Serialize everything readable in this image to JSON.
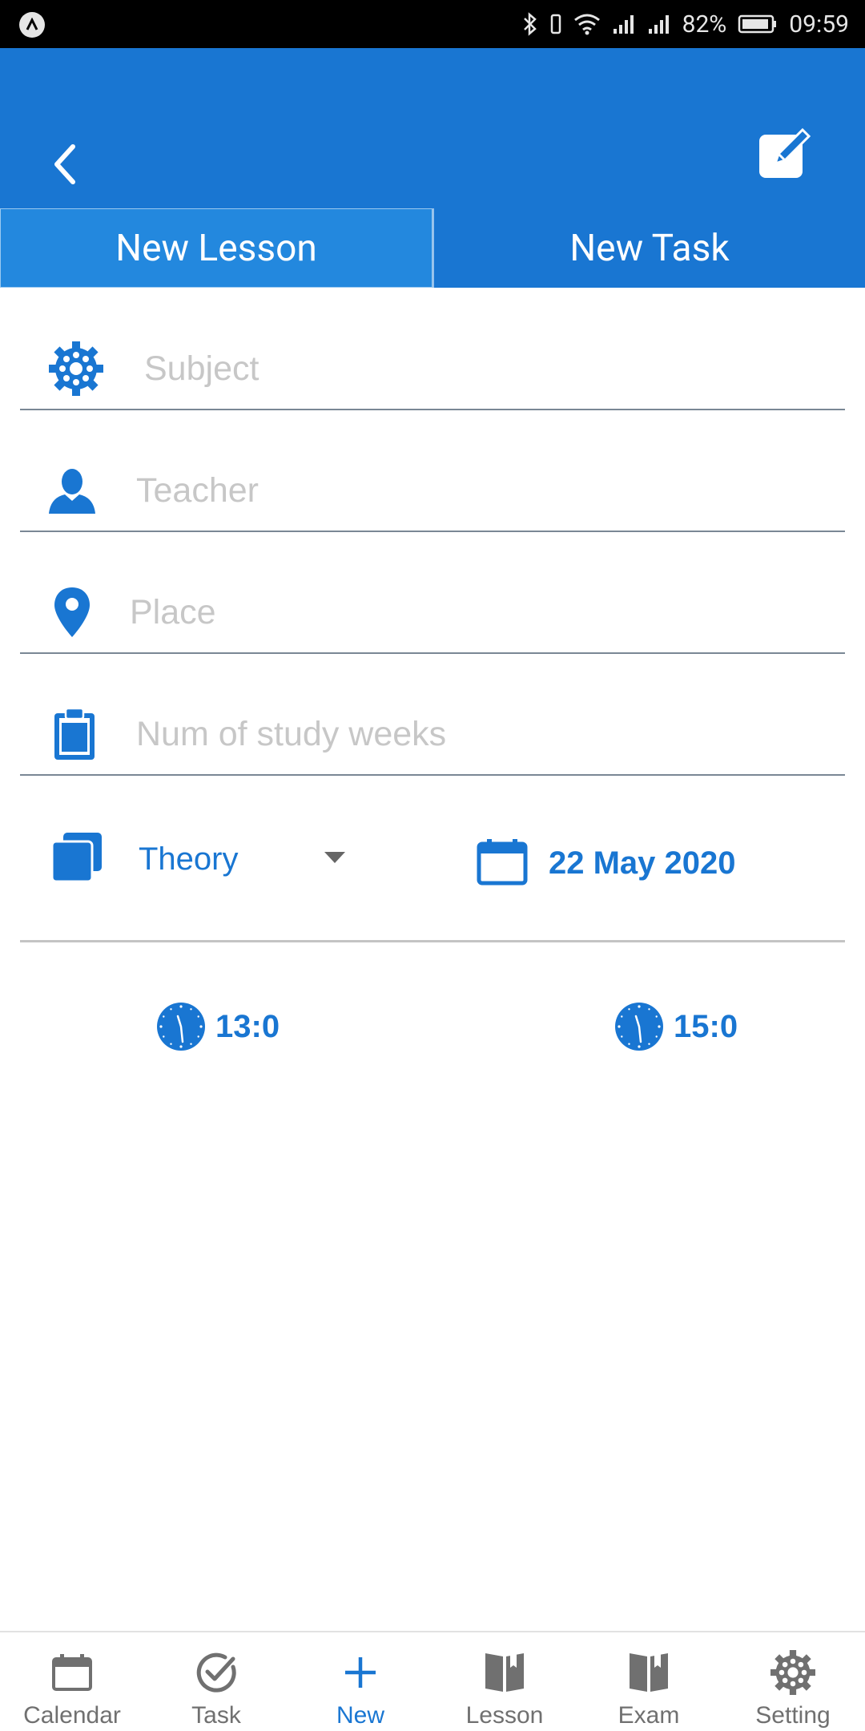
{
  "status_bar": {
    "battery": "82%",
    "time": "09:59"
  },
  "tabs": [
    {
      "label": "New Lesson",
      "active": true
    },
    {
      "label": "New Task",
      "active": false
    }
  ],
  "form": {
    "subject_placeholder": "Subject",
    "teacher_placeholder": "Teacher",
    "place_placeholder": "Place",
    "weeks_placeholder": "Num of study weeks",
    "type_value": "Theory",
    "date_value": "22 May 2020",
    "start_time": "13:0",
    "end_time": "15:0"
  },
  "bottom_nav": [
    {
      "label": "Calendar",
      "icon": "calendar-icon"
    },
    {
      "label": "Task",
      "icon": "check-circle-icon"
    },
    {
      "label": "New",
      "icon": "plus-icon",
      "active": true
    },
    {
      "label": "Lesson",
      "icon": "book-icon"
    },
    {
      "label": "Exam",
      "icon": "book-icon"
    },
    {
      "label": "Setting",
      "icon": "gear-icon"
    }
  ],
  "colors": {
    "primary": "#1976d2",
    "tab_active": "#2388de",
    "placeholder": "#c7c7c7",
    "nav_inactive": "#707070"
  }
}
